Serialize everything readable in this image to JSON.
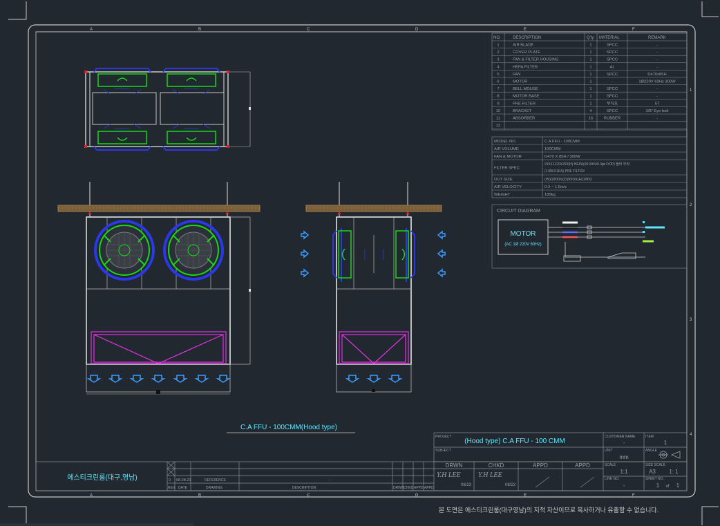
{
  "border": {
    "columns": [
      "A",
      "B",
      "C",
      "D",
      "E",
      "F"
    ],
    "rows": [
      "1",
      "2",
      "3",
      "4"
    ]
  },
  "bom": {
    "headers": {
      "no": "NO.",
      "desc": "DESCRIPTION",
      "qty": "Q'ty",
      "material": "MATERIAL",
      "remark": "REMARK"
    },
    "rows": [
      {
        "no": "1",
        "desc": "AIR BLADE",
        "qty": "1",
        "material": "SPCC",
        "remark": "-"
      },
      {
        "no": "2",
        "desc": "COVER PLATE",
        "qty": "1",
        "material": "SPCC",
        "remark": "-"
      },
      {
        "no": "3",
        "desc": "FAN & FILTER HOUSING",
        "qty": "1",
        "material": "SPCC",
        "remark": "-"
      },
      {
        "no": "4",
        "desc": "HEPA FILTER",
        "qty": "1",
        "material": "AL",
        "remark": "-"
      },
      {
        "no": "5",
        "desc": "FAN",
        "qty": "1",
        "material": "SPCC",
        "remark": "D470x85H"
      },
      {
        "no": "6",
        "desc": "MOTOR",
        "qty": "1",
        "material": "-",
        "remark": "1Ø220V 60Hz 300W"
      },
      {
        "no": "7",
        "desc": "BELL MOUSE",
        "qty": "1",
        "material": "SPCC",
        "remark": "-"
      },
      {
        "no": "8",
        "desc": "MOTOR BASE",
        "qty": "1",
        "material": "SPCC",
        "remark": "-"
      },
      {
        "no": "9",
        "desc": "PRE FILTER",
        "qty": "1",
        "material": "부직포",
        "remark": "5T"
      },
      {
        "no": "10",
        "desc": "BRACKET",
        "qty": "4",
        "material": "SPCC",
        "remark": "3/8\" Eye bolt"
      },
      {
        "no": "11",
        "desc": "ABSORBER",
        "qty": "16",
        "material": "RUBBER",
        "remark": "-"
      },
      {
        "no": "12",
        "desc": "",
        "qty": "",
        "material": "",
        "remark": ""
      }
    ]
  },
  "spec": {
    "rows": [
      {
        "label": "MODEL NO.",
        "value": "C.A FFU - 100CMM"
      },
      {
        "label": "AIR VOLUME",
        "value": "100CMM"
      },
      {
        "label": "FAN & MOTOR",
        "value": "D470 X 85H / 300W"
      },
      {
        "label": "FILTER SPEC",
        "value": "915X1220X292(H) HEPA(99.99%/0.3㎛ DOP) 필터 부착",
        "value2": "(1세트X1EA) PRE FILTER"
      },
      {
        "label": "OUT SIZE",
        "value": "(W)1800X(D)950X(H)1800"
      },
      {
        "label": "AIR VELOCITY",
        "value": "0.3 ~ 1.5m/s"
      },
      {
        "label": "WEIGHT",
        "value": "185kg"
      }
    ]
  },
  "circuit": {
    "title": "CIRCUIT DIAGRAM",
    "motor_label": "MOTOR",
    "motor_sub": "(AC 1Ø 220V 60Hz)"
  },
  "view_title": "C.A FFU - 100CMM(Hood type)",
  "title_block": {
    "project_label": "PROJECT",
    "project_title": "(Hood type) C.A FFU - 100 CMM",
    "subject_label": "SUBJECT",
    "customer_label": "CUSTOMER NAME",
    "customer_value": "-",
    "item_label": "ITEM",
    "item_value": "1",
    "unit_label": "UNIT",
    "unit_value": "mm",
    "angle_label": "ANGLE",
    "scale_label": "SCALE",
    "scale_value": "1:1",
    "size_label": "SIZE SCALE",
    "size_value": "A3",
    "size_scale_value": "1: 1",
    "line_label": "LINE NO.",
    "line_value": "-",
    "sheet_label": "SHEET NO.",
    "sheet_value": "1",
    "sheet_of": "of",
    "sheet_total": "1",
    "company": "에스티크린룸(대구,영남)",
    "drwn_label": "DRWN",
    "chkd_label": "CHKD",
    "appd_label": "APPD",
    "appd2_label": "APPD",
    "drwn_sign": "Y.H LEE",
    "chkd_sign": "Y.H LEE",
    "drwn_date": "08/23",
    "chkd_date": "08/23",
    "rev_no": "0",
    "rev_date": "08.08.23",
    "rev_label": "REV.",
    "date_label": "DATE",
    "reference_label": "REFERENCE",
    "drawing_label": "DRAWING",
    "description_label": "DESCRIPTION",
    "dash": "-",
    "drwn_small": "DRWN",
    "chkd_small": "CHKD",
    "appd_small": "APPD",
    "appd2_small": "APPD"
  },
  "footer_note": "본 도면은 에스티크린룸(대구영남)의 지적 자산이므로 복사하거나 유출할 수 없습니다.",
  "colors": {
    "background": "#212830",
    "line": "#d8d8d8",
    "grid": "#8a8f95",
    "fan_blue": "#2a38e6",
    "fan_green": "#18d818",
    "filter_magenta": "#e633e6",
    "arrow_blue": "#3a9cff",
    "ceiling": "#8a6a40",
    "cyan_text": "#5ee8ff",
    "red": "#e02020"
  }
}
